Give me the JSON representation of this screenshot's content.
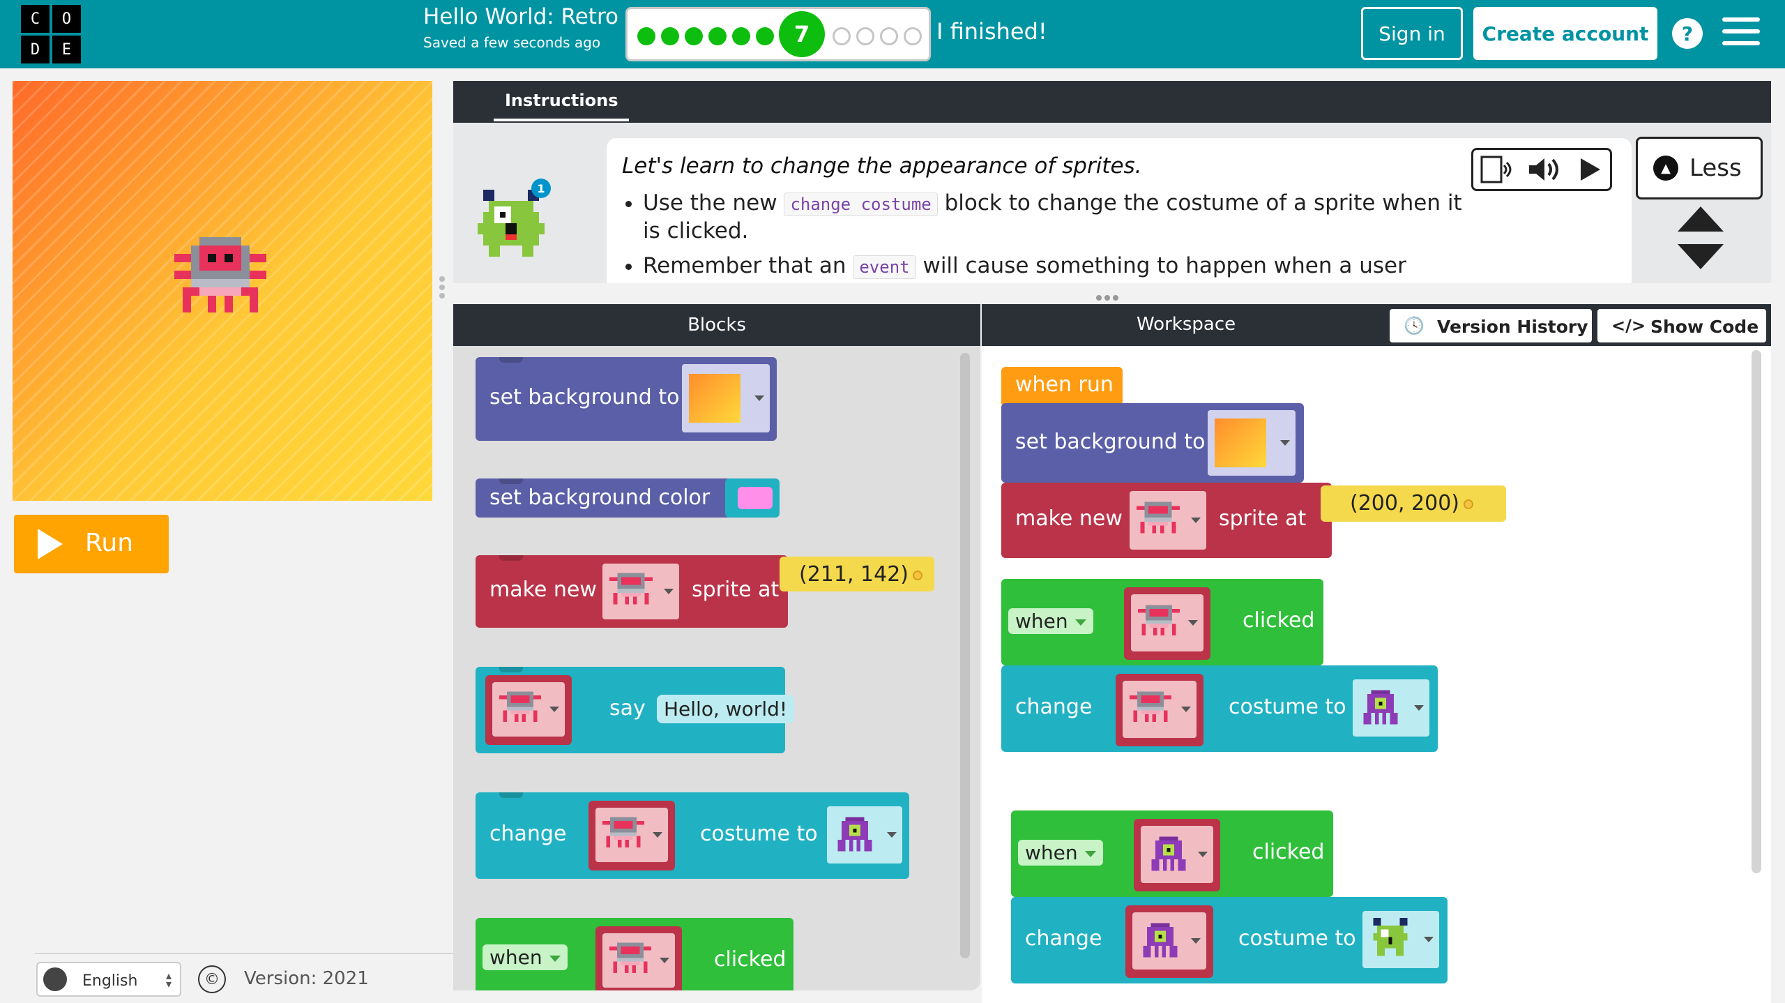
{
  "header": {
    "logo_letters": [
      "C",
      "O",
      "D",
      "E"
    ],
    "level_title": "Hello World: Retro",
    "save_status": "Saved a few seconds ago",
    "progress": {
      "completed_levels": 6,
      "current_level": "7",
      "remaining_levels": 4
    },
    "finished_text": "I finished!",
    "sign_in": "Sign in",
    "create_account": "Create account",
    "help": "?"
  },
  "left": {
    "run_label": "Run",
    "language": "English",
    "copyright": "©",
    "version": "Version: 2021"
  },
  "instructions": {
    "tab": "Instructions",
    "hint_count": "1",
    "lead": "Let's learn to change the appearance of sprites.",
    "bullet1_pre": "Use the new",
    "bullet1_code": "change costume",
    "bullet1_post": "block to change the costume of a sprite when it is clicked.",
    "bullet2_pre": "Remember that an",
    "bullet2_code": "event",
    "bullet2_post": "will cause something to happen when a user interacts",
    "less_label": "Less"
  },
  "editor": {
    "blocks_title": "Blocks",
    "workspace_title": "Workspace",
    "version_history": "Version History",
    "show_code": "Show Code"
  },
  "toolbox_blocks": {
    "set_background_to": "set background to",
    "set_background_color": "set background color",
    "make_new": "make new",
    "sprite_at": "sprite at",
    "coords": "(211, 142)",
    "say": "say",
    "say_text": "Hello, world!",
    "change": "change",
    "costume_to": "costume to",
    "when": "when",
    "clicked": "clicked"
  },
  "workspace_blocks": {
    "when_run": "when run",
    "set_background_to": "set background to",
    "make_new": "make new",
    "sprite_at": "sprite at",
    "coords": "(200, 200)",
    "when1": "when",
    "clicked1": "clicked",
    "change1": "change",
    "costume_to1": "costume to",
    "when2": "when",
    "clicked2": "clicked",
    "change2": "change",
    "costume_to2": "costume to"
  },
  "colors": {
    "header": "#0094a3",
    "run_button": "#ffa400",
    "block_purple": "#5b5fa7",
    "block_red": "#ba3349",
    "block_teal": "#20b1c3",
    "block_green": "#2fbf3a",
    "block_orange": "#ff9c12",
    "progress_green": "#0ebe0e"
  },
  "icons": [
    "globe-icon",
    "speaker-icon",
    "play-icon",
    "clock-icon",
    "code-icon",
    "hamburger-icon",
    "chevron-up-icon"
  ]
}
